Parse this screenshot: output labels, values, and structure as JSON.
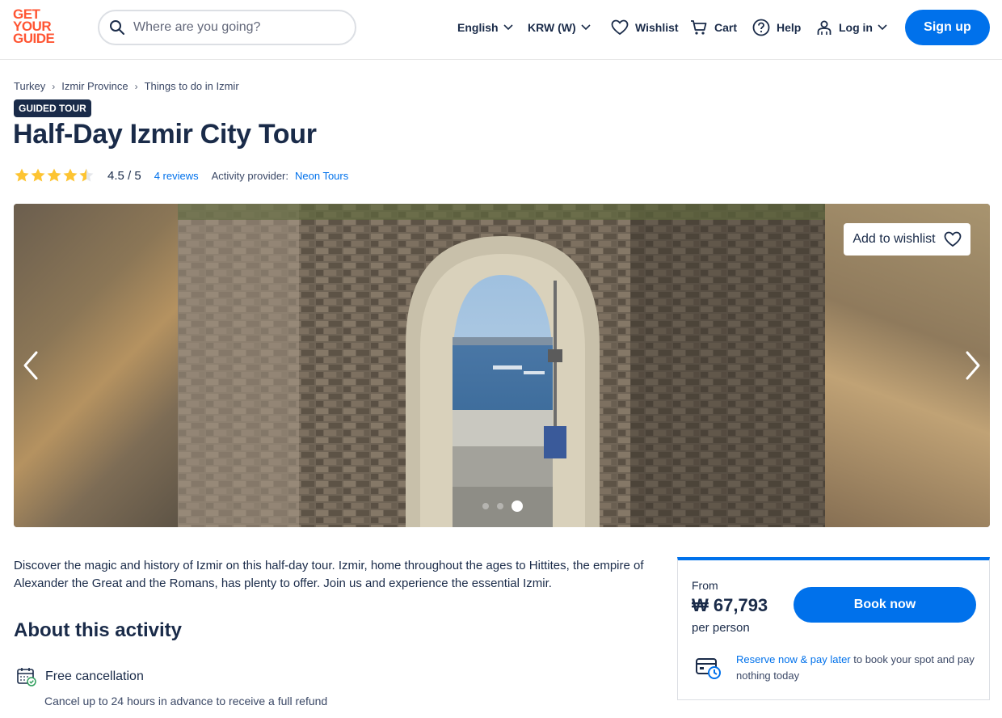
{
  "header": {
    "logo_lines": [
      "GET",
      "YOUR",
      "GUIDE"
    ],
    "search_placeholder": "Where are you going?",
    "language": "English",
    "currency": "KRW (W)",
    "wishlist": "Wishlist",
    "cart": "Cart",
    "help": "Help",
    "login": "Log in",
    "signup": "Sign up"
  },
  "breadcrumb": [
    "Turkey",
    "Izmir Province",
    "Things to do in Izmir"
  ],
  "badge": "GUIDED TOUR",
  "title": "Half-Day Izmir City Tour",
  "rating": {
    "value": 4.5,
    "text": "4.5 / 5",
    "reviews": "4 reviews",
    "provider_label": "Activity provider:",
    "provider": "Neon Tours"
  },
  "gallery": {
    "wishlist_button": "Add to wishlist",
    "image_count": 3,
    "active_index": 2
  },
  "description": "Discover the magic and history of Izmir on this half-day tour. Izmir, home throughout the ages to Hittites, the empire of Alexander the Great and the Romans, has plenty to offer. Join us and experience the essential Izmir.",
  "about": {
    "heading": "About this activity",
    "features": [
      {
        "title": "Free cancellation",
        "subtitle": "Cancel up to 24 hours in advance to receive a full refund"
      }
    ]
  },
  "booking": {
    "from": "From",
    "price": "₩ 67,793",
    "per": "per person",
    "book_button": "Book now",
    "reserve_link": "Reserve now & pay later",
    "reserve_text": " to book your spot and pay nothing today"
  },
  "colors": {
    "brand": "#ff5533",
    "accent": "#0071eb",
    "text": "#1a2b49",
    "star": "#fdc432"
  }
}
